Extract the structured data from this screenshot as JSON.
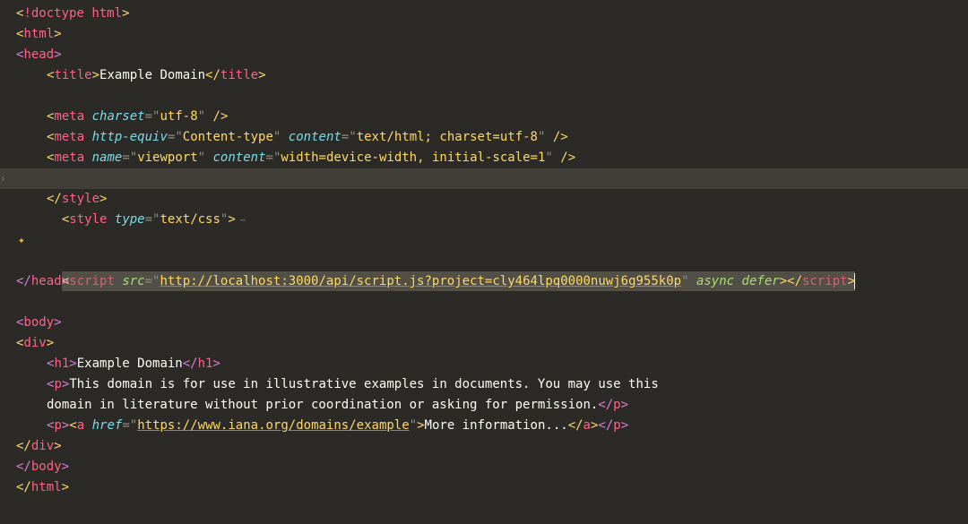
{
  "code": {
    "doctype": {
      "bang": "!",
      "kw": "doctype",
      "val": "html"
    },
    "tag_html_open": "html",
    "tag_head_open": "head",
    "title": {
      "tag": "title",
      "text": "Example Domain"
    },
    "meta1": {
      "tag": "meta",
      "attr": "charset",
      "val": "utf-8"
    },
    "meta2": {
      "tag": "meta",
      "a1": "http-equiv",
      "v1": "Content-type",
      "a2": "content",
      "v2": "text/html; charset=utf-8"
    },
    "meta3": {
      "tag": "meta",
      "a1": "name",
      "v1": "viewport",
      "a2": "content",
      "v2": "width=device-width, initial-scale=1"
    },
    "style_open": {
      "tag": "style",
      "attr": "type",
      "val": "text/css"
    },
    "style_close": "style",
    "script_line": {
      "tag": "script",
      "attr_src": "src",
      "url": "http://localhost:3000/api/script.js?project=cly464lpq0000nuwj6g955k0p",
      "a_async": "async",
      "a_defer": "defer"
    },
    "tag_head_close": "head",
    "tag_body_open": "body",
    "tag_div_open": "div",
    "h1": {
      "tag": "h1",
      "text": "Example Domain"
    },
    "p1": {
      "tag": "p",
      "textA": "This domain is for use in illustrative examples in documents. You may use this",
      "textB": "domain in literature without prior coordination or asking for permission."
    },
    "p2": {
      "tag": "p",
      "a_tag": "a",
      "href_attr": "href",
      "href_val": "https://www.iana.org/domains/example",
      "link_text": "More information..."
    },
    "tag_div_close": "div",
    "tag_body_close": "body",
    "tag_html_close": "html"
  },
  "gutter": {
    "arrow": "›",
    "sparkle": "✦"
  }
}
